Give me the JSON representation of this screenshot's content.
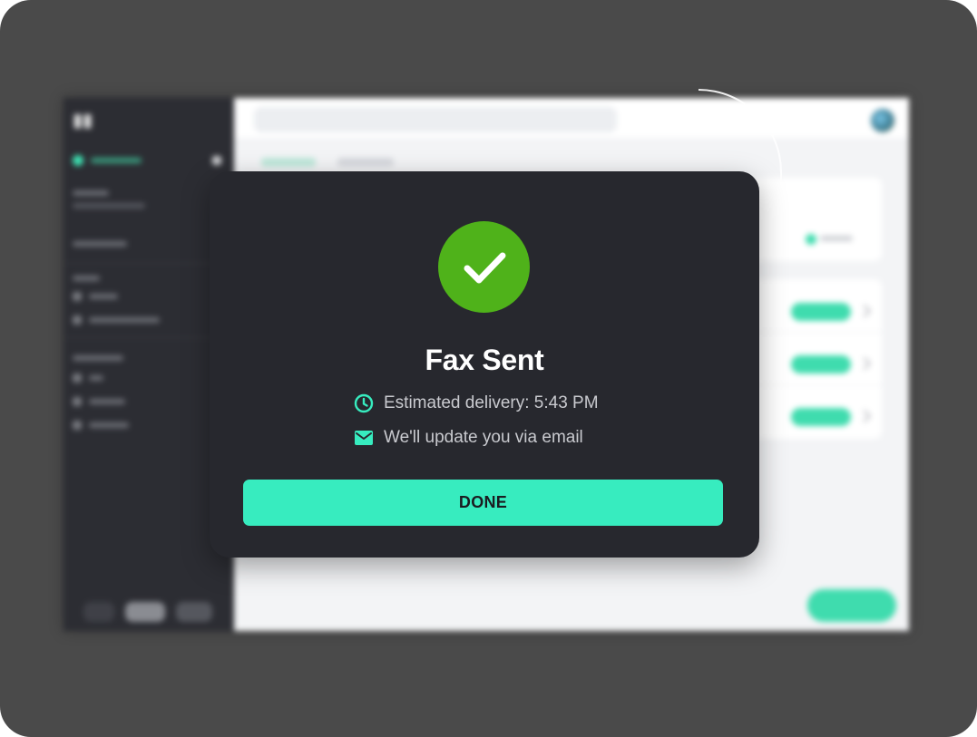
{
  "modal": {
    "title": "Fax Sent",
    "delivery_text": "Estimated delivery: 5:43 PM",
    "email_text": "We'll update you via email",
    "done_label": "DONE",
    "icons": {
      "status": "checkmark-icon",
      "delivery": "clock-icon",
      "email": "envelope-icon"
    }
  },
  "colors": {
    "success": "#4fb21a",
    "accent": "#37ecbf",
    "modal_bg": "#27282e",
    "backdrop": "#4a4a4a"
  }
}
